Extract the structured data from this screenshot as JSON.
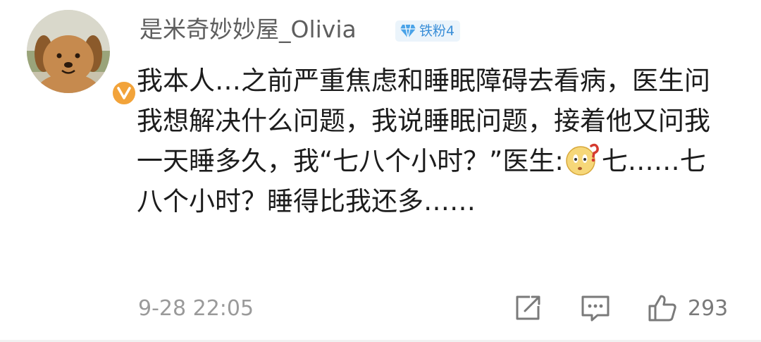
{
  "user": {
    "name": "是米奇妙妙屋_Olivia",
    "fan_badge": "铁粉4"
  },
  "comment": {
    "text_parts": [
      "我本人…之前严重焦虑和睡眠障碍去看病，医生问我想解决什么问题，我说睡眠问题，接着他又问我一天睡多久，我“七八个小时？”医生:",
      "七……七八个小时？睡得比我还多……"
    ],
    "emoji": "confused-face-emoji"
  },
  "meta": {
    "timestamp": "9-28 22:05",
    "like_count": "293"
  },
  "colors": {
    "name": "#5e5e5e",
    "text": "#1c1c1c",
    "badge_bg": "#ebf4fb",
    "badge_text": "#3b8fd8",
    "verified": "#f2a33a",
    "muted": "#9a9a9a"
  }
}
